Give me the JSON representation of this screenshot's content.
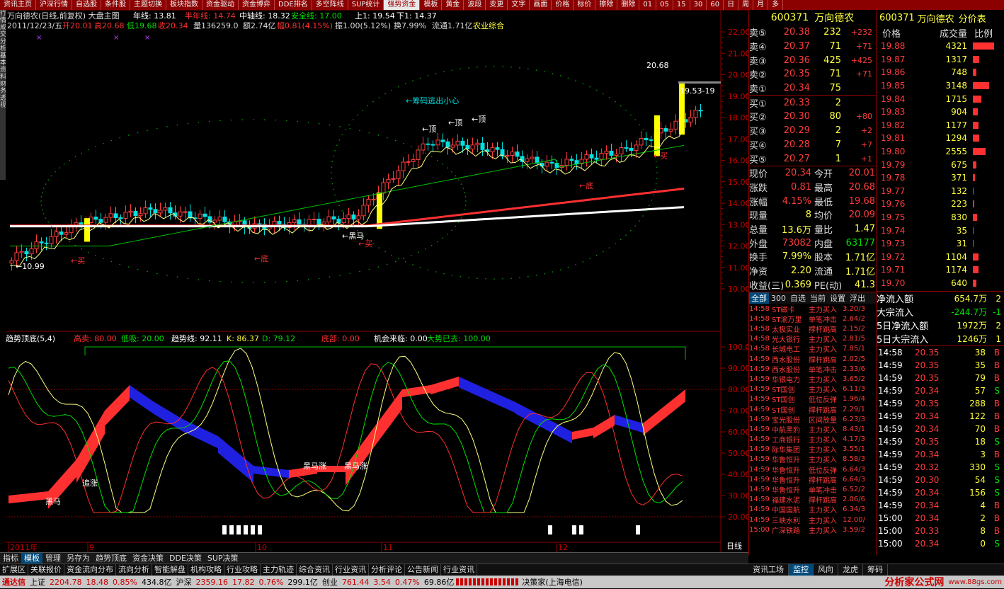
{
  "topbar": [
    "资讯主页",
    "沪深行情",
    "自选股",
    "条件股",
    "主题切换",
    "板块指数",
    "资金驱动",
    "资金博弈",
    "DDE排名",
    "多空阵线",
    "SUP统计",
    "强势资金",
    "模板",
    "黄金",
    "波段",
    "变更",
    "文字",
    "画面",
    "价格",
    "标价",
    "擦除",
    "删除",
    "01",
    "05",
    "15",
    "30",
    "60",
    "日",
    "周",
    "月",
    "多"
  ],
  "lefttabs": [
    "行情",
    "成交",
    "分析",
    "基本资料",
    "财务透视"
  ],
  "header": {
    "line1": "万向德农(日线,前复权) 大盘主图",
    "ma1": "年线: 13.81",
    "ma2": "半年线: 14.74",
    "ma3": "中轴线: 18.32",
    "ma4": "安全线: 17.00",
    "ma5": "上1: 19.54",
    "ma6": "下1: 14.37",
    "line2a": "2011/12/23/五",
    "open": "开20.01",
    "high": "高20.68",
    "low": "低19.68",
    "close": "收20.34",
    "vol": "量136259.0",
    "amt": "额2.74亿",
    "chg": "幅0.81(4.15%)",
    "amp": "振1.00(5.12%)",
    "turn": "换7.99%",
    "flow": "流通1.71亿",
    "sector": "农业综合"
  },
  "annotations": {
    "chip": "←筹码逃出小心",
    "top1": "←顶",
    "top2": "←顶",
    "top3": "←顶",
    "buy1": "←买",
    "buy2": "←买",
    "buy3": "←买",
    "bottom1": "←底",
    "bottom2": "←底",
    "blackhorse": "←黑马",
    "min": "←10.99",
    "max": "20.68",
    "label1953": "19.53-19"
  },
  "price_axis": [
    "22.00",
    "21.00",
    "20.00",
    "19.00",
    "18.00",
    "17.00",
    "16.00",
    "15.00",
    "14.00",
    "13.00",
    "12.00",
    "11.00",
    "10.00"
  ],
  "ind_header": {
    "name": "趋势顶底(5,4)",
    "sell": "高卖: 80.00",
    "low": "低吸: 20.00",
    "trend": "趋势线: 92.11",
    "k": "K: 86.37",
    "d": "D: 79.12",
    "bottom": "底部: 0.00",
    "chance": "机会来临: 0.00",
    "gone": "大势已去: 100.00"
  },
  "ind_axis": [
    "100.00",
    "90.00",
    "80.00",
    "70.00",
    "60.00",
    "50.00",
    "40.00",
    "30.00",
    "20.00"
  ],
  "ind_ann": {
    "chase": "追涨",
    "bh": "黑马",
    "dark1": "黑马涨",
    "dark2": "黑马涨"
  },
  "time_axis": [
    "2011年",
    "9",
    "10",
    "11",
    "12"
  ],
  "period": "日线",
  "quote": {
    "code": "600371",
    "name": "万向德农",
    "sells": [
      [
        "卖⑤",
        "20.38",
        "232",
        "+232"
      ],
      [
        "卖④",
        "20.37",
        "71",
        "+71"
      ],
      [
        "卖③",
        "20.36",
        "425",
        "+425"
      ],
      [
        "卖②",
        "20.35",
        "71",
        "+71"
      ],
      [
        "卖①",
        "20.34",
        "75",
        ""
      ]
    ],
    "buys": [
      [
        "买①",
        "20.33",
        "2",
        ""
      ],
      [
        "买②",
        "20.30",
        "80",
        "+80"
      ],
      [
        "买③",
        "20.29",
        "2",
        "+2"
      ],
      [
        "买④",
        "20.28",
        "7",
        "+7"
      ],
      [
        "买⑤",
        "20.27",
        "1",
        "+1"
      ]
    ],
    "stats": [
      [
        "现价",
        "20.34",
        "今开",
        "20.01"
      ],
      [
        "涨跌",
        "0.81",
        "最高",
        "20.68"
      ],
      [
        "涨幅",
        "4.15%",
        "最低",
        "19.68"
      ],
      [
        "现量",
        "8",
        "均价",
        "20.09"
      ],
      [
        "总量",
        "13.6万",
        "量比",
        "1.47"
      ],
      [
        "外盘",
        "73082",
        "内盘",
        "63177"
      ],
      [
        "换手",
        "7.99%",
        "股本",
        "1.71亿"
      ],
      [
        "净资",
        "2.20",
        "流通",
        "1.71亿"
      ],
      [
        "收益(三)",
        "0.369",
        "PE(动)",
        "41.3"
      ]
    ]
  },
  "mini_tabs": [
    "全部",
    "300",
    "自选",
    "当前",
    "设置",
    "浮出"
  ],
  "news": [
    [
      "14:58",
      "ST磁卡",
      "主力买入",
      "3.20/3"
    ],
    [
      "14:58",
      "ST渝万里",
      "单笔冲击",
      "2.64/2"
    ],
    [
      "14:58",
      "太极实业",
      "撑杆跳高",
      "2.15/2"
    ],
    [
      "14:58",
      "光大银行",
      "主力买入",
      "2.81/5"
    ],
    [
      "14:58",
      "长城电工",
      "主力买入",
      "7.85/1"
    ],
    [
      "14:59",
      "西水股份",
      "撑杆跳高",
      "2.02/5"
    ],
    [
      "14:59",
      "西水股份",
      "单笔冲击",
      "2.33/6"
    ],
    [
      "14:59",
      "华银电力",
      "主力买入",
      "3.65/2"
    ],
    [
      "14:59",
      "ST国创",
      "主力买入",
      "6.11/3"
    ],
    [
      "14:59",
      "ST国创",
      "低位反弹",
      "1.96/4"
    ],
    [
      "14:59",
      "ST国创",
      "撑杆跳高",
      "2.29/1"
    ],
    [
      "14:59",
      "宝光股份",
      "区间放量",
      "6.23/3"
    ],
    [
      "14:59",
      "中航黑豹",
      "主力买入",
      "8.43/1"
    ],
    [
      "14:59",
      "工商银行",
      "主力买入",
      "4.17/3"
    ],
    [
      "14:59",
      "际华集团",
      "主力买入",
      "3.55/1"
    ],
    [
      "14:59",
      "华鲁恒升",
      "主力买入",
      "8.58/3"
    ],
    [
      "14:59",
      "华鲁恒升",
      "低位反弹",
      "6.64/3"
    ],
    [
      "14:59",
      "华鲁恒升",
      "撑杆跳高",
      "6.64/3"
    ],
    [
      "14:59",
      "华鲁恒升",
      "单笔冲击",
      "6.52/2"
    ],
    [
      "14:59",
      "福建水泥",
      "撑杆跳高",
      "2.06/6"
    ],
    [
      "14:59",
      "中国国航",
      "主力买入",
      "6.34/3"
    ],
    [
      "14:59",
      "三峡水利",
      "主力买入",
      "12.00/"
    ],
    [
      "15:00",
      "广深铁路",
      "主力买入",
      "3.59/2"
    ]
  ],
  "depth_header": {
    "code": "600371",
    "name": "万向德农",
    "tab": "分价表",
    "c1": "价格",
    "c2": "成交量",
    "c3": "比例"
  },
  "depth": [
    [
      "19.88",
      "4321",
      60
    ],
    [
      "19.87",
      "1317",
      18
    ],
    [
      "19.86",
      "748",
      10
    ],
    [
      "19.85",
      "3148",
      45
    ],
    [
      "19.84",
      "1715",
      24
    ],
    [
      "19.83",
      "904",
      13
    ],
    [
      "19.82",
      "1177",
      16
    ],
    [
      "19.81",
      "1294",
      18
    ],
    [
      "19.80",
      "2555",
      36
    ],
    [
      "19.79",
      "675",
      9
    ],
    [
      "19.78",
      "371",
      5
    ],
    [
      "19.77",
      "132",
      2
    ],
    [
      "19.76",
      "223",
      3
    ],
    [
      "19.75",
      "830",
      12
    ],
    [
      "19.74",
      "35",
      1
    ],
    [
      "19.73",
      "31",
      1
    ],
    [
      "19.72",
      "1104",
      15
    ],
    [
      "19.71",
      "1174",
      16
    ],
    [
      "19.70",
      "640",
      9
    ]
  ],
  "flow": [
    [
      "净流入额",
      "654.7万",
      "2"
    ],
    [
      "大宗流入",
      "-244.7万",
      "-1"
    ],
    [
      "5日净流入额",
      "1972万",
      "2"
    ],
    [
      "5日大宗流入",
      "1246万",
      "1"
    ]
  ],
  "ticks": [
    [
      "14:58",
      "20.35",
      "38",
      "B"
    ],
    [
      "14:59",
      "20.35",
      "35",
      "B"
    ],
    [
      "14:59",
      "20.35",
      "79",
      "B"
    ],
    [
      "14:59",
      "20.34",
      "57",
      "S"
    ],
    [
      "14:59",
      "20.35",
      "288",
      "B"
    ],
    [
      "14:59",
      "20.34",
      "122",
      "B"
    ],
    [
      "14:59",
      "20.34",
      "70",
      "B"
    ],
    [
      "14:59",
      "20.35",
      "18",
      "S"
    ],
    [
      "14:59",
      "20.34",
      "3",
      "B"
    ],
    [
      "14:59",
      "20.32",
      "330",
      "S"
    ],
    [
      "14:59",
      "20.30",
      "54",
      "S"
    ],
    [
      "14:59",
      "20.34",
      "156",
      "S"
    ],
    [
      "14:59",
      "20.34",
      "4",
      "B"
    ],
    [
      "15:00",
      "20.34",
      "2",
      "B"
    ],
    [
      "15:00",
      "20.33",
      "8",
      "B"
    ],
    [
      "15:00",
      "20.34",
      "0",
      "S"
    ]
  ],
  "bottomtabs": [
    "指标",
    "模板",
    "管理",
    "另存为",
    "趋势顶底",
    "资金决策",
    "DDE决策",
    "SUP决策"
  ],
  "bottomtabs2": [
    "扩展区",
    "关联报价",
    "资金流向分布",
    "流向分析",
    "智能解盘",
    "机构攻略",
    "行业攻略",
    "主力轨迹",
    "综合资讯",
    "行业资讯",
    "分析评论",
    "公告新闻",
    "行业资讯"
  ],
  "rtabs": [
    "资讯工场",
    "监控",
    "风向",
    "龙虎",
    "筹码"
  ],
  "status": {
    "app": "通达信",
    "sh": "上证",
    "shv": "2204.78",
    "shc": "18.48",
    "shp": "0.85%",
    "sha": "434.8亿",
    "sz": "沪深",
    "szv": "2359.16",
    "szc": "17.82",
    "szp": "0.76%",
    "sza": "299.1亿",
    "cy": "创业",
    "cyv": "761.44",
    "cyc": "3.54",
    "cyp": "0.47%",
    "cya": "69.86亿",
    "broker": "决策家(上海电信)"
  },
  "watermark": "分析家公式网",
  "watermark_url": "www.88gs.com"
}
